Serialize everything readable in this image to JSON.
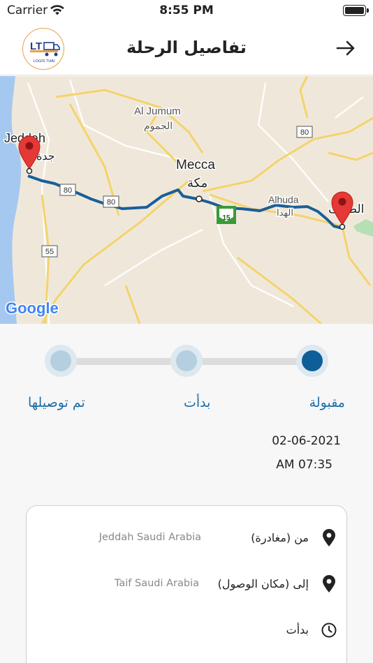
{
  "status_bar": {
    "carrier": "Carrier",
    "time": "8:55 PM"
  },
  "header": {
    "title": "تفاصيل الرحلة",
    "logo_text": "LT",
    "logo_subtext": "LOGIS THAI"
  },
  "map": {
    "labels": {
      "jeddah_en": "Jeddah",
      "jeddah_ar": "جدة",
      "jumum_en": "Al Jumum",
      "jumum_ar": "الجموم",
      "mecca_en": "Mecca",
      "mecca_ar": "مكة",
      "alhuda_en": "Alhuda",
      "alhuda_ar": "الهدا",
      "taif_ar": "الطائف",
      "road_80a": "80",
      "road_80b": "80",
      "road_80c": "80",
      "road_55": "55",
      "road_15": "15",
      "google": "Google"
    }
  },
  "stepper": {
    "steps": [
      "مقبولة",
      "بدأت",
      "تم توصيلها"
    ],
    "active_index": 0
  },
  "trip": {
    "date": "02-06-2021",
    "time": "AM 07:35"
  },
  "details": {
    "from_label": "من (مغادرة)",
    "from_value": "Jeddah Saudi Arabia",
    "to_label": "إلى (مكان الوصول)",
    "to_value": "Taif Saudi Arabia",
    "status_label": "بدأت"
  },
  "colors": {
    "accent": "#0e5f99",
    "step_text": "#1a6ea8",
    "route": "#1a5e9a",
    "pin": "#e53935"
  }
}
